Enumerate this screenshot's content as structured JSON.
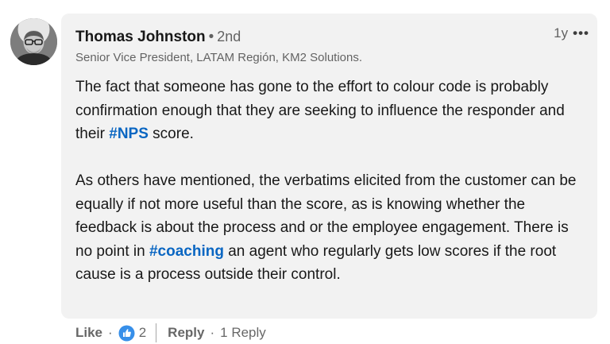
{
  "author": {
    "name": "Thomas Johnston",
    "separator": "•",
    "degree": "2nd",
    "headline": "Senior Vice President, LATAM Región, KM2 Solutions."
  },
  "meta": {
    "timestamp": "1y",
    "more_label": "•••"
  },
  "comment": {
    "p1_before": "The fact that someone has gone to the effort to colour code is probably confirmation enough that they are seeking to influence the responder and their ",
    "p1_hashtag": "#NPS",
    "p1_after": " score.",
    "p2_before": "As others have mentioned, the verbatims elicited from the customer can be equally if not more useful than the score, as is knowing whether the feedback is about the process and or the employee engagement. There is no point in ",
    "p2_hashtag": "#coaching",
    "p2_after": " an agent who regularly gets low scores if the root cause is a process outside their control."
  },
  "actions": {
    "like_label": "Like",
    "dot": "·",
    "reaction_count": "2",
    "reply_label": "Reply",
    "reply_count": "1 Reply"
  },
  "colors": {
    "bubble_bg": "#f2f2f2",
    "hashtag": "#0a66c2",
    "like_reaction": "#378fe9"
  },
  "icons": {
    "like_reaction": "thumbs-up-icon",
    "more": "ellipsis-icon"
  }
}
